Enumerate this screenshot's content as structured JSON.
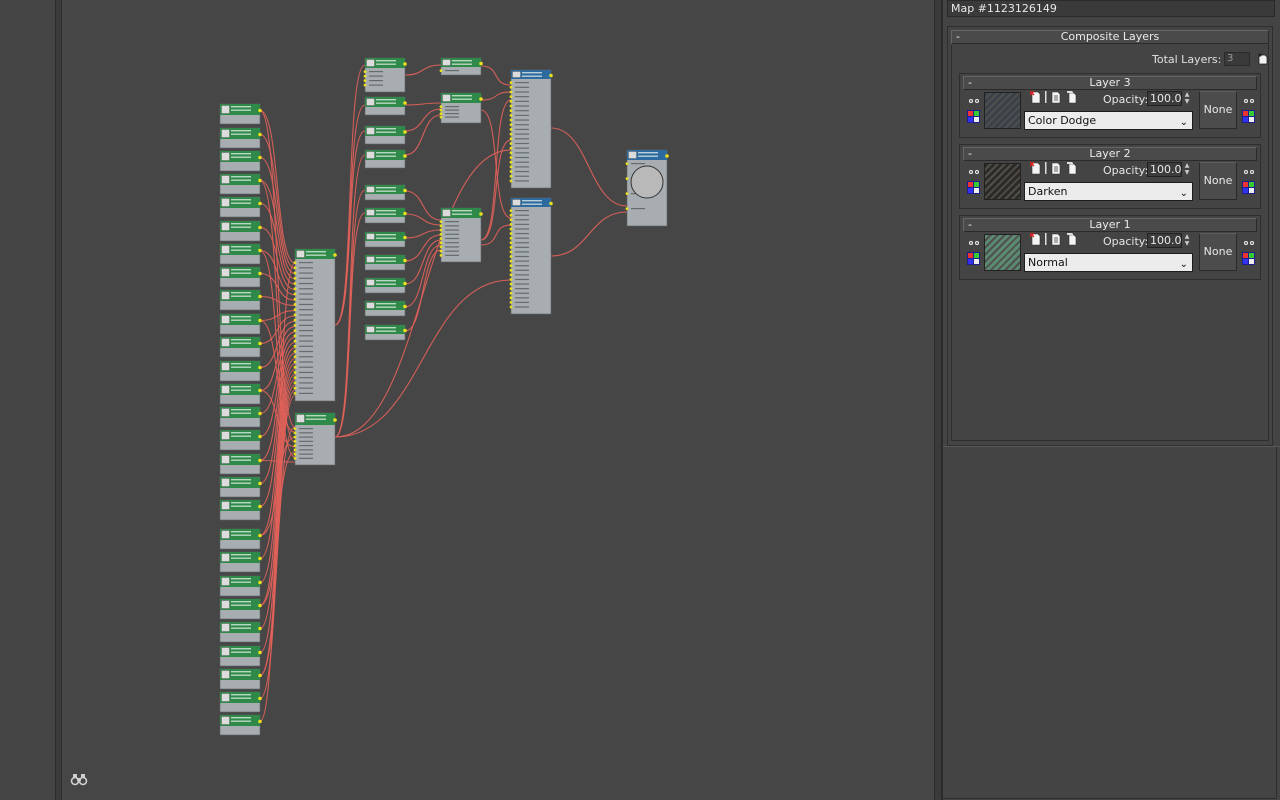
{
  "view": {
    "nodes": [
      {
        "name": "bitmap-node",
        "count": 27
      },
      {
        "name": "multi-input-node",
        "count": 2
      }
    ]
  },
  "panel": {
    "map_name": "Map #1123126149",
    "rollout_title": "Composite Layers",
    "rollout_toggle": "-",
    "total_label": "Total Layers:",
    "total_value": "3",
    "layers": [
      {
        "title": "Layer 3",
        "toggle": "-",
        "opacity_label": "Opacity:",
        "opacity": "100.0",
        "blend": "Color Dodge",
        "mask": "None",
        "thumb_color": "#3b4148"
      },
      {
        "title": "Layer 2",
        "toggle": "-",
        "opacity_label": "Opacity:",
        "opacity": "100.0",
        "blend": "Darken",
        "mask": "None",
        "thumb_color": "#2e2a24"
      },
      {
        "title": "Layer 1",
        "toggle": "-",
        "opacity_label": "Opacity:",
        "opacity": "100.0",
        "blend": "Normal",
        "mask": "None",
        "thumb_color": "#5a8a70"
      }
    ]
  },
  "colors": {
    "wire": "#e3625a",
    "socket": "#e8e01c",
    "node_green": "#2f8a4a",
    "node_blue": "#2c6aa0",
    "node_body": "#a7adb0"
  },
  "icons": [
    "find-icon",
    "add-layer-icon",
    "visibility-icon",
    "color-correct-icon"
  ]
}
